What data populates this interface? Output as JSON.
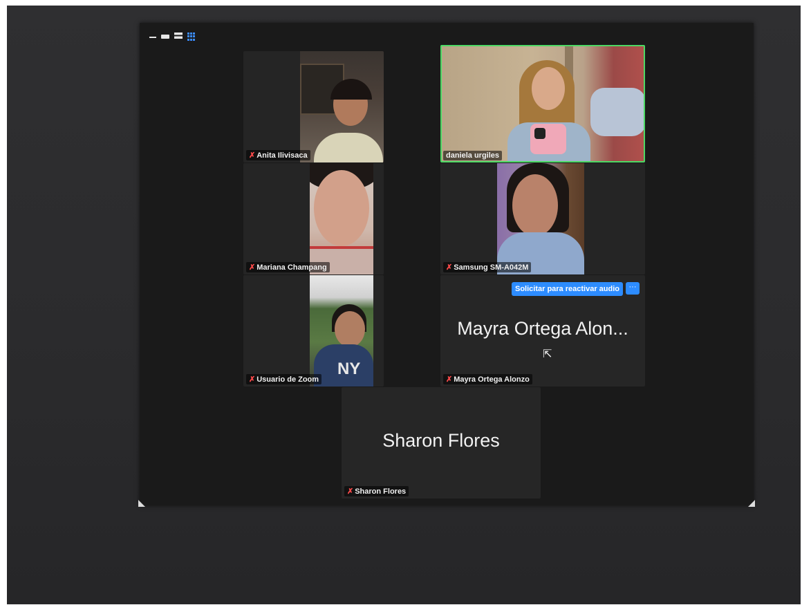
{
  "toolbar": {
    "layout_icons": [
      "minimize-icon",
      "speaker-view-icon",
      "stacked-view-icon",
      "gallery-view-icon"
    ]
  },
  "participants": [
    {
      "name": "Anita Ilivisaca",
      "muted": true,
      "video": true
    },
    {
      "name": "daniela urgiles",
      "muted": false,
      "video": true,
      "active_speaker": true
    },
    {
      "name": "Mariana Champang",
      "muted": true,
      "video": true
    },
    {
      "name": "Samsung SM-A042M",
      "muted": true,
      "video": true
    },
    {
      "name": "Usuario de Zoom",
      "muted": true,
      "video": true
    },
    {
      "name": "Mayra Ortega Alonzo",
      "display_name": "Mayra Ortega Alon...",
      "muted": true,
      "video": false
    },
    {
      "name": "Sharon Flores",
      "display_name": "Sharon Flores",
      "muted": true,
      "video": false
    }
  ],
  "actions": {
    "ask_unmute_label": "Solicitar para reactivar audio",
    "more_label": "···"
  },
  "icons": {
    "mute": "✗"
  },
  "colors": {
    "active_border": "#4cd964",
    "button_blue": "#2d8cff",
    "mute_red": "#ff4a4a"
  }
}
